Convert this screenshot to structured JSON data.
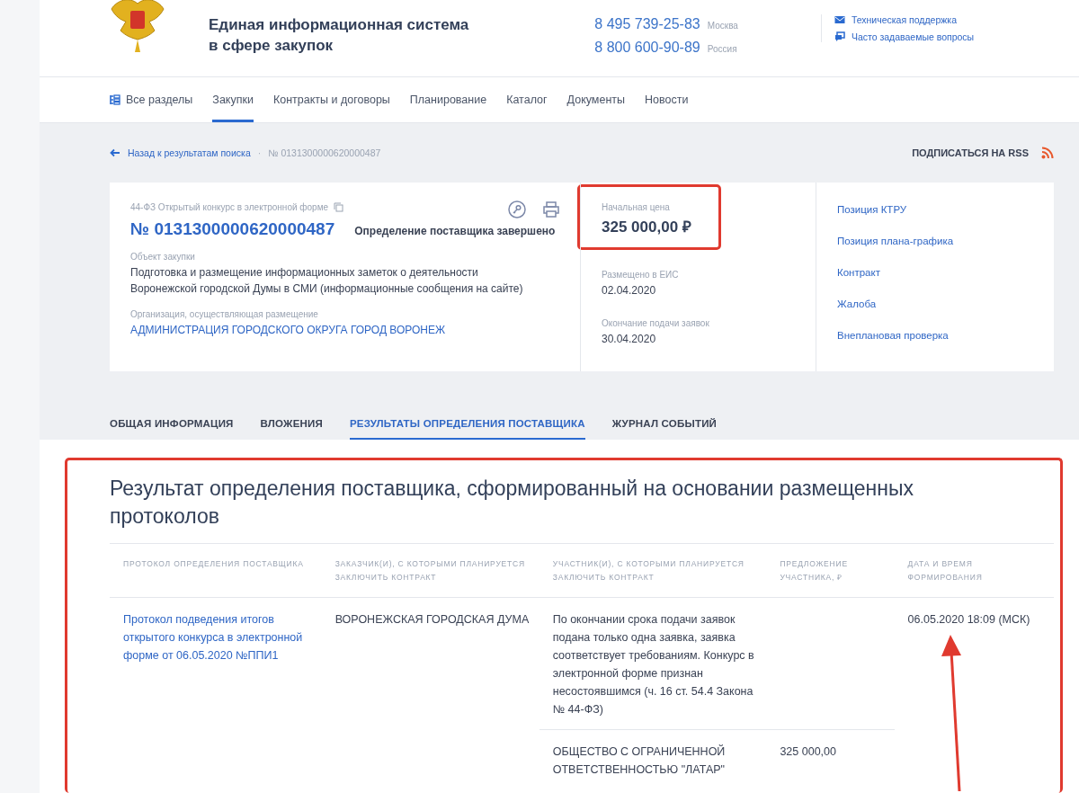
{
  "header": {
    "title_lines": [
      "Единая информационная система",
      "в сфере закупок"
    ],
    "phones": [
      {
        "number": "8 495 739-25-83",
        "region": "Москва"
      },
      {
        "number": "8 800 600-90-89",
        "region": "Россия"
      }
    ],
    "links": [
      {
        "kind": "mail",
        "label": "Техническая поддержка"
      },
      {
        "kind": "chat",
        "label": "Часто задаваемые вопросы"
      }
    ]
  },
  "nav": [
    {
      "label": "Все разделы",
      "kind": "sections",
      "selected": false
    },
    {
      "label": "Закупки",
      "kind": "plain",
      "selected": true
    },
    {
      "label": "Контракты и договоры",
      "kind": "plain",
      "selected": false
    },
    {
      "label": "Планирование",
      "kind": "plain",
      "selected": false
    },
    {
      "label": "Каталог",
      "kind": "plain",
      "selected": false
    },
    {
      "label": "Документы",
      "kind": "plain",
      "selected": false
    },
    {
      "label": "Новости",
      "kind": "plain",
      "selected": false
    }
  ],
  "breadcrumb": {
    "back": "Назад к результатам поиска",
    "separator": "·",
    "current": "№ 0131300000620000487"
  },
  "rss": "ПОДПИСАТЬСЯ НА RSS",
  "card": {
    "type": "44-ФЗ Открытый конкурс в электронной форме",
    "number": "№ 0131300000620000487",
    "status": "Определение поставщика завершено",
    "fields": [
      {
        "label": "Объект закупки",
        "value": "Подготовка и размещение информационных заметок о деятельности Воронежской городской Думы в СМИ (информационные сообщения на сайте)",
        "kind": "text"
      },
      {
        "label": "Организация, осуществляющая размещение",
        "value": "АДМИНИСТРАЦИЯ ГОРОДСКОГО ОКРУГА ГОРОД ВОРОНЕЖ",
        "kind": "link"
      }
    ],
    "price_label": "Начальная цена",
    "price": "325 000,00 ₽",
    "dates": [
      {
        "label": "Размещено в ЕИС",
        "value": "02.04.2020"
      },
      {
        "label": "Окончание подачи заявок",
        "value": "30.04.2020"
      }
    ],
    "side_links": [
      "Позиция КТРУ",
      "Позиция плана-графика",
      "Контракт",
      "Жалоба",
      "Внеплановая проверка"
    ]
  },
  "tabs": [
    {
      "label": "ОБЩАЯ ИНФОРМАЦИЯ",
      "selected": false
    },
    {
      "label": "ВЛОЖЕНИЯ",
      "selected": false
    },
    {
      "label": "РЕЗУЛЬТАТЫ ОПРЕДЕЛЕНИЯ ПОСТАВЩИКА",
      "selected": true
    },
    {
      "label": "ЖУРНАЛ СОБЫТИЙ",
      "selected": false
    }
  ],
  "results": {
    "title": "Результат определения поставщика, сформированный на основании размещенных протоколов",
    "columns": [
      "ПРОТОКОЛ ОПРЕДЕЛЕНИЯ ПОСТАВЩИКА",
      "ЗАКАЗЧИК(И), С КОТОРЫМИ ПЛАНИРУЕТСЯ ЗАКЛЮЧИТЬ КОНТРАКТ",
      "УЧАСТНИК(И), С КОТОРЫМИ ПЛАНИРУЕТСЯ ЗАКЛЮЧИТЬ КОНТРАКТ",
      "ПРЕДЛОЖЕНИЕ УЧАСТНИКА, ₽",
      "ДАТА И ВРЕМЯ ФОРМИРОВАНИЯ"
    ],
    "rows": [
      {
        "protocol": "Протокол подведения итогов открытого конкурса в электронной форме от 06.05.2020 №ППИ1",
        "customer": "ВОРОНЕЖСКАЯ ГОРОДСКАЯ ДУМА",
        "participants": [
          {
            "text": "По окончании срока подачи заявок подана только одна заявка, заявка соответствует требованиям. Конкурс в электронной форме признан несостоявшимся (ч. 16 ст. 54.4 Закона № 44-ФЗ)"
          },
          {
            "text": "ОБЩЕСТВО С ОГРАНИЧЕННОЙ ОТВЕТСТВЕННОСТЬЮ \"ЛАТАР\"",
            "offer": "325 000,00"
          }
        ],
        "date": "06.05.2020 18:09 (МСК)"
      }
    ]
  }
}
